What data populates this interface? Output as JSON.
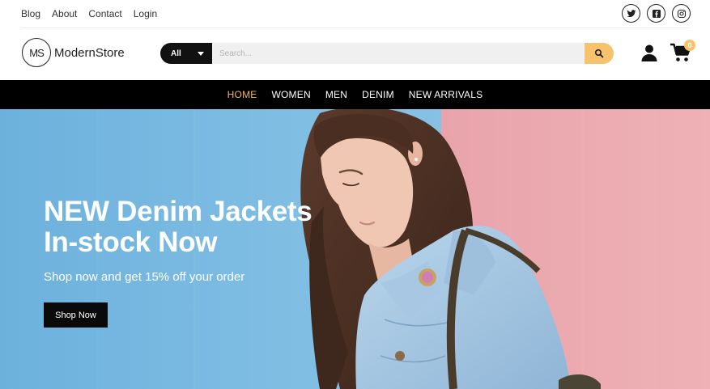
{
  "topbar": {
    "links": [
      "Blog",
      "About",
      "Contact",
      "Login"
    ],
    "socials": [
      {
        "icon": "twitter-icon"
      },
      {
        "icon": "facebook-icon"
      },
      {
        "icon": "instagram-icon"
      }
    ]
  },
  "header": {
    "logo_mark": "MS",
    "logo_text": "ModernStore",
    "search": {
      "category": "All",
      "placeholder": "Search...",
      "button_icon": "search-icon"
    },
    "user_icon": "user-icon",
    "cart_icon": "cart-icon",
    "cart_count": "0"
  },
  "nav": {
    "items": [
      "HOME",
      "WOMEN",
      "MEN",
      "DENIM",
      "NEW ARRIVALS"
    ],
    "active": "HOME"
  },
  "hero": {
    "title_line1": "NEW Denim Jackets",
    "title_line2": "In-stock Now",
    "subtitle": "Shop now and get 15% off your order",
    "cta": "Shop Now"
  },
  "colors": {
    "accent": "#f6c26b",
    "nav_bg": "#000000",
    "hero_blue": "#79b8df",
    "hero_pink": "#eba7ad",
    "denim": "#a9cbe6"
  }
}
